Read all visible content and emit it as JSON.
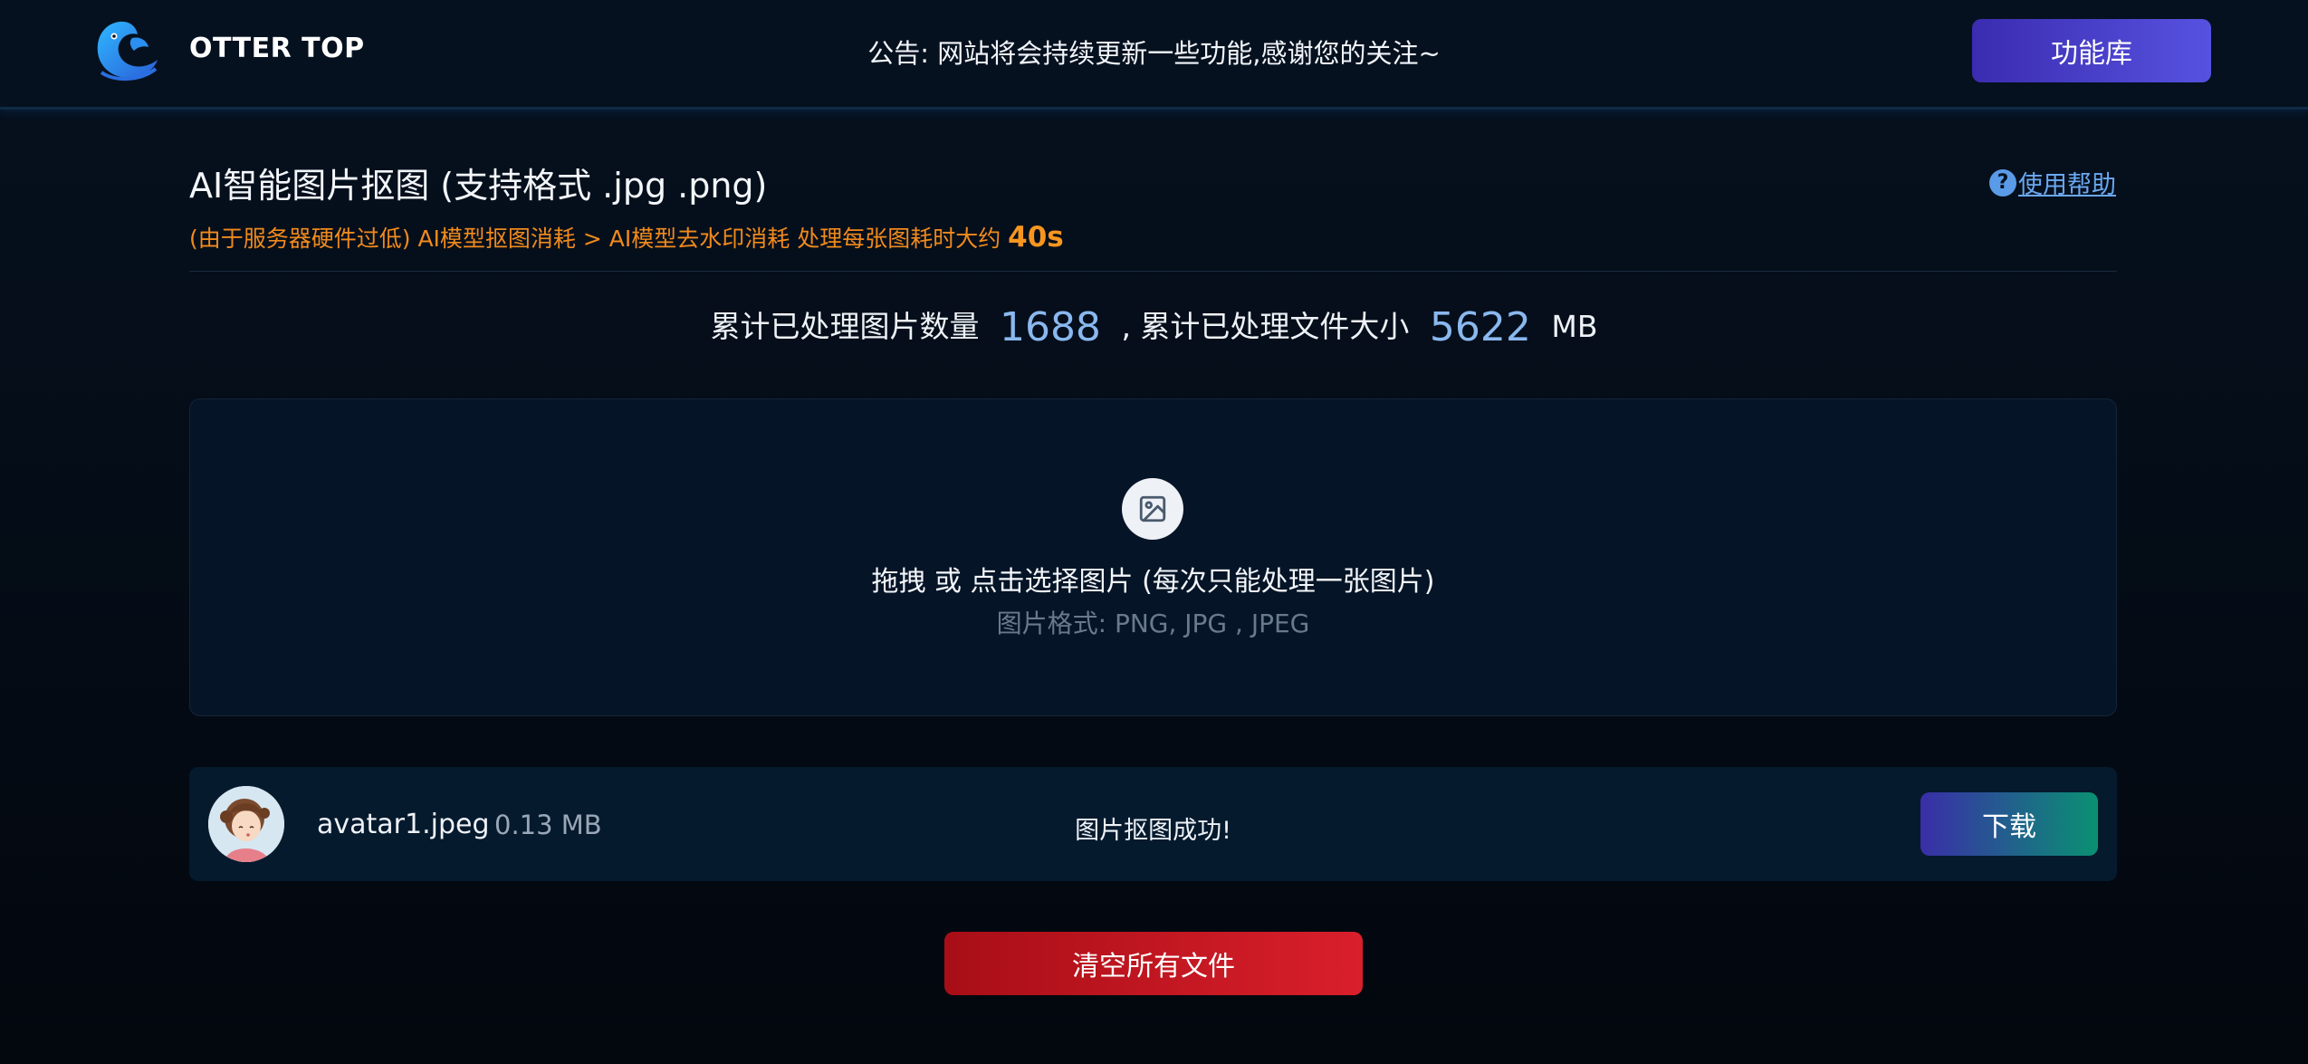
{
  "header": {
    "brand": "OTTER TOP",
    "notice": "公告: 网站将会持续更新一些功能,感谢您的关注~",
    "library_button": "功能库",
    "logo_icon": "otter-logo-icon"
  },
  "main": {
    "title": "AI智能图片抠图 (支持格式 .jpg .png)",
    "help_icon": "question-circle-icon",
    "help_link": "使用帮助",
    "note_text": "(由于服务器硬件过低) AI模型抠图消耗 > AI模型去水印消耗 处理每张图耗时大约",
    "note_time": "40s",
    "stats": {
      "count_label": "累计已处理图片数量",
      "count": "1688",
      "size_label": ", 累计已处理文件大小",
      "size": "5622",
      "unit": "MB"
    }
  },
  "upload": {
    "icon": "image-icon",
    "main_text": "拖拽 或 点击选择图片 (每次只能处理一张图片)",
    "format_text": "图片格式: PNG, JPG , JPEG"
  },
  "file": {
    "name": "avatar1.jpeg",
    "size": "0.13 MB",
    "status": "图片抠图成功!",
    "download_button": "下载"
  },
  "actions": {
    "clear_button": "清空所有文件"
  },
  "colors": {
    "background": "#06111f",
    "accent_purple": "#5652e0",
    "note_orange": "#f08a1c",
    "stat_blue": "#8ab8ef",
    "danger_red": "#d91f2b",
    "success_green": "#0a9172"
  }
}
